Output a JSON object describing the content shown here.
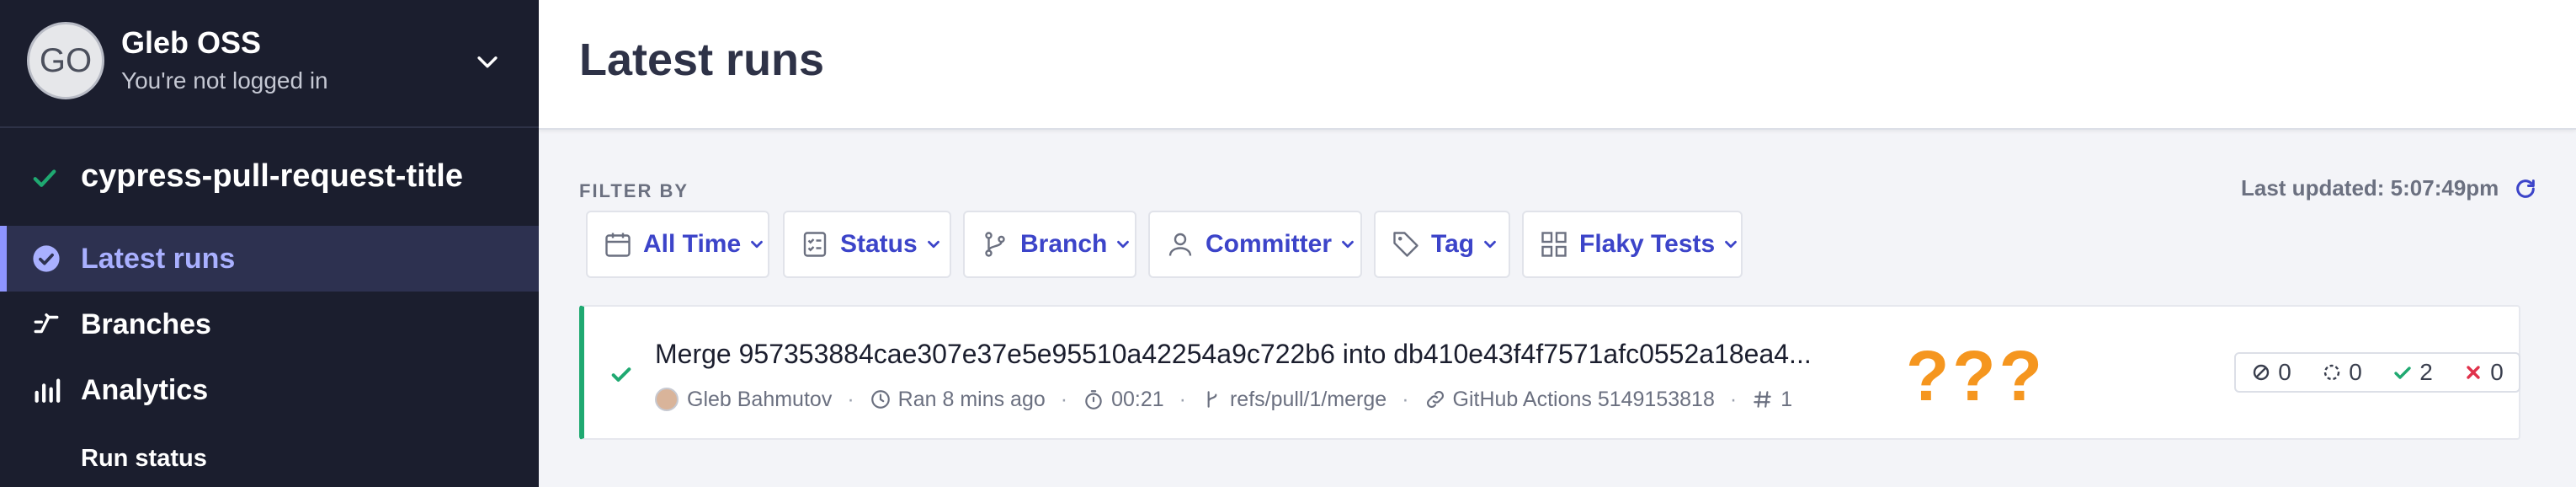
{
  "account": {
    "initials": "GO",
    "name": "Gleb OSS",
    "status": "You're not logged in"
  },
  "project": {
    "name": "cypress-pull-request-title"
  },
  "nav": {
    "latest_runs": "Latest runs",
    "branches": "Branches",
    "analytics": "Analytics",
    "run_status": "Run status"
  },
  "header": {
    "title": "Latest runs"
  },
  "filters": {
    "label": "FILTER BY",
    "last_updated": "Last updated: 5:07:49pm",
    "items": [
      "All Time",
      "Status",
      "Branch",
      "Committer",
      "Tag",
      "Flaky Tests"
    ]
  },
  "run": {
    "title": "Merge 957353884cae307e37e5e95510a42254a9c722b6 into db410e43f4f7571afc0552a18ea4...",
    "author": "Gleb Bahmutov",
    "ran": "Ran 8 mins ago",
    "duration": "00:21",
    "ref": "refs/pull/1/merge",
    "ci": "GitHub Actions 5149153818",
    "number": "1",
    "annotation": "???",
    "stats": {
      "skipped": "0",
      "pending": "0",
      "passed": "2",
      "failed": "0"
    }
  },
  "colors": {
    "accent": "#3c44c9",
    "pass": "#1fa971",
    "fail": "#e0324b",
    "annotation": "#f5961f",
    "sidebar": "#1b1e2e"
  }
}
